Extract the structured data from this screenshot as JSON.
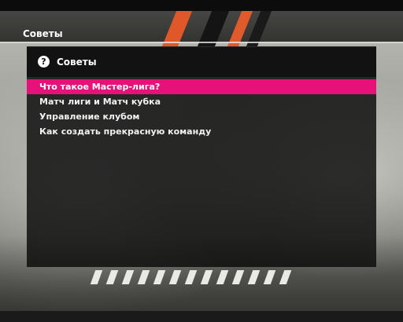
{
  "window": {
    "title": "Советы"
  },
  "panel": {
    "title": "Советы",
    "icon": "help-icon",
    "icon_glyph": "?"
  },
  "menu": {
    "items": [
      {
        "label": "Что такое Мастер-лига?",
        "selected": true
      },
      {
        "label": "Матч лиги и Матч кубка",
        "selected": false
      },
      {
        "label": "Управление клубом",
        "selected": false
      },
      {
        "label": "Как создать прекрасную команду",
        "selected": false
      }
    ]
  },
  "colors": {
    "highlight": "#e6127a",
    "panel": "#0a0a0a",
    "text": "#ffffff",
    "accent_stripe": "#e0572a"
  }
}
